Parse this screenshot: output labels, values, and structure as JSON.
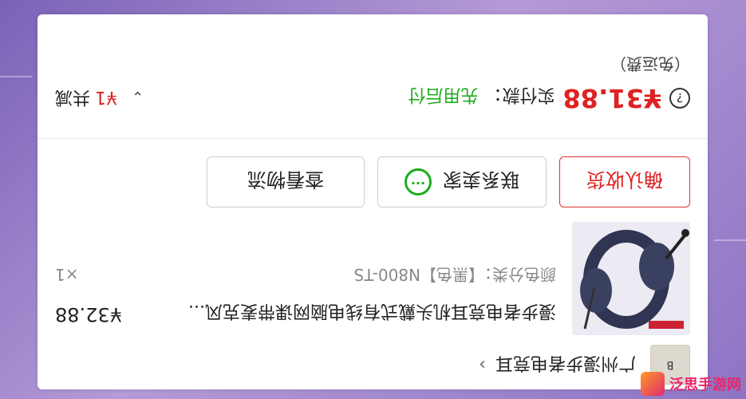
{
  "shop": {
    "logo_text": "B",
    "name": "广州漫步者电竞耳",
    "chevron": "›"
  },
  "item": {
    "title": "漫步者电竞耳机头戴式有线电脑网课带麦克风...",
    "spec": "颜色分类：【黑色】N800-TS",
    "price": "¥32.88",
    "qty": "×1"
  },
  "actions": {
    "view_logistics": "查看物流",
    "contact_seller": "联系卖家",
    "confirm_receipt": "确认收货"
  },
  "summary": {
    "q_icon": "?",
    "total_price": "¥31.88",
    "paid_label": "实付款：",
    "pay_method": "先用后付",
    "total_label": "共减",
    "total_count": "¥1",
    "chevron": "⌄",
    "shipping_note": "（免运费）"
  },
  "watermark": {
    "text": "泛思手游网"
  },
  "colors": {
    "accent_red": "#dd2222",
    "wechat_green": "#1aad19",
    "bg_purple": "#9b83cc"
  }
}
